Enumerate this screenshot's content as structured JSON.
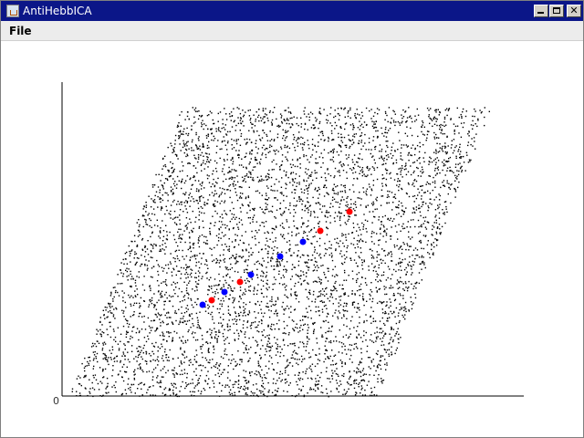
{
  "window": {
    "title": "AntiHebbICA",
    "controls": [
      "minimize",
      "maximize",
      "close"
    ],
    "title_bar_color": "#0b1688"
  },
  "menubar": {
    "items": [
      {
        "label": "File"
      }
    ]
  },
  "plot": {
    "origin_label": "0",
    "point_cloud_color": "#000000",
    "red_weights_color": "#ff0000",
    "blue_weights_color": "#0000ff"
  }
}
